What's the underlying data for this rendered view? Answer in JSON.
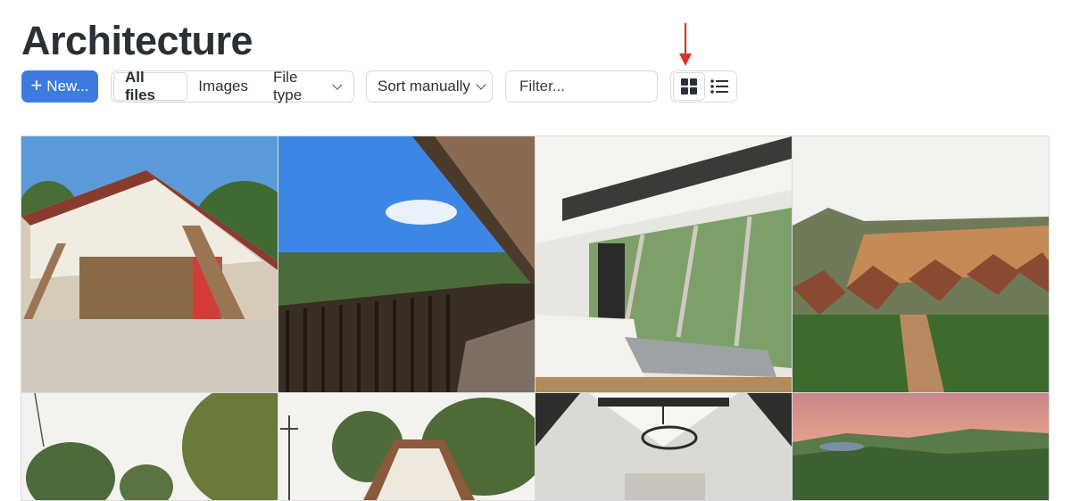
{
  "page": {
    "title": "Architecture"
  },
  "toolbar": {
    "new_label": "New...",
    "tabs": [
      {
        "label": "All files",
        "active": true
      },
      {
        "label": "Images",
        "active": false
      },
      {
        "label": "File type",
        "active": false,
        "has_dropdown": true
      }
    ],
    "sort_label": "Sort manually",
    "filter_placeholder": "Filter...",
    "view_modes": [
      {
        "name": "grid",
        "icon": "grid-icon",
        "active": true
      },
      {
        "name": "list",
        "icon": "list-icon",
        "active": false
      }
    ]
  },
  "colors": {
    "accent": "#3d7be0",
    "annotation_arrow": "#e0302b"
  },
  "gallery": {
    "items": [
      {
        "alt": "A-frame carport with red door"
      },
      {
        "alt": "Wooden balcony with lounge chairs"
      },
      {
        "alt": "A-frame bedroom with large windows"
      },
      {
        "alt": "Aerial view of hillside A-frame cabins"
      },
      {
        "alt": "Tree-lined hillside"
      },
      {
        "alt": "A-frame house exterior"
      },
      {
        "alt": "A-frame interior with chandelier"
      },
      {
        "alt": "Sunset over green hills"
      }
    ]
  }
}
